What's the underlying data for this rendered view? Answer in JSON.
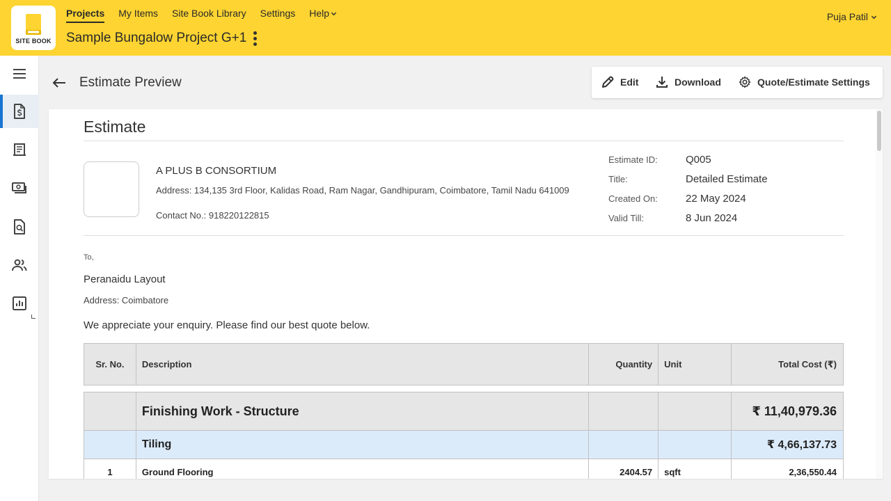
{
  "brand": {
    "logo_text": "SITE BOOK"
  },
  "nav": {
    "items": [
      {
        "label": "Projects"
      },
      {
        "label": "My Items"
      },
      {
        "label": "Site Book Library"
      },
      {
        "label": "Settings"
      },
      {
        "label": "Help"
      }
    ]
  },
  "project": {
    "title": "Sample Bungalow Project G+1"
  },
  "user": {
    "name": "Puja Patil"
  },
  "page": {
    "title": "Estimate Preview"
  },
  "toolbar": {
    "edit_label": "Edit",
    "download_label": "Download",
    "settings_label": "Quote/Estimate Settings"
  },
  "doc": {
    "heading": "Estimate",
    "company": {
      "name": "A PLUS B CONSORTIUM",
      "address": "Address: 134,135 3rd Floor, Kalidas Road, Ram Nagar, Gandhipuram, Coimbatore, Tamil Nadu 641009",
      "contact": "Contact No.: 918220122815"
    },
    "meta": [
      {
        "label": "Estimate ID:",
        "value": "Q005"
      },
      {
        "label": "Title:",
        "value": "Detailed Estimate"
      },
      {
        "label": "Created On:",
        "value": "22 May 2024"
      },
      {
        "label": "Valid Till:",
        "value": "8 Jun 2024"
      }
    ],
    "to_label": "To,",
    "client": {
      "name": "Peranaidu Layout",
      "address": "Address: Coimbatore"
    },
    "intro": "We appreciate your enquiry. Please find our best quote below.",
    "table": {
      "headers": [
        "Sr. No.",
        "Description",
        "Quantity",
        "Unit",
        "Total Cost (₹)"
      ],
      "section": {
        "title": "Finishing Work - Structure",
        "total": "₹ 11,40,979.36"
      },
      "subsection": {
        "title": "Tiling",
        "total": "₹ 4,66,137.73"
      },
      "rows": [
        {
          "sr": "1",
          "description": "Ground Flooring",
          "quantity": "2404.57",
          "unit": "sqft",
          "total": "2,36,550.44"
        }
      ]
    }
  },
  "colors": {
    "topbar": "#fdd431",
    "accent": "#1976d2",
    "subsection_bg": "#dcebfa"
  }
}
